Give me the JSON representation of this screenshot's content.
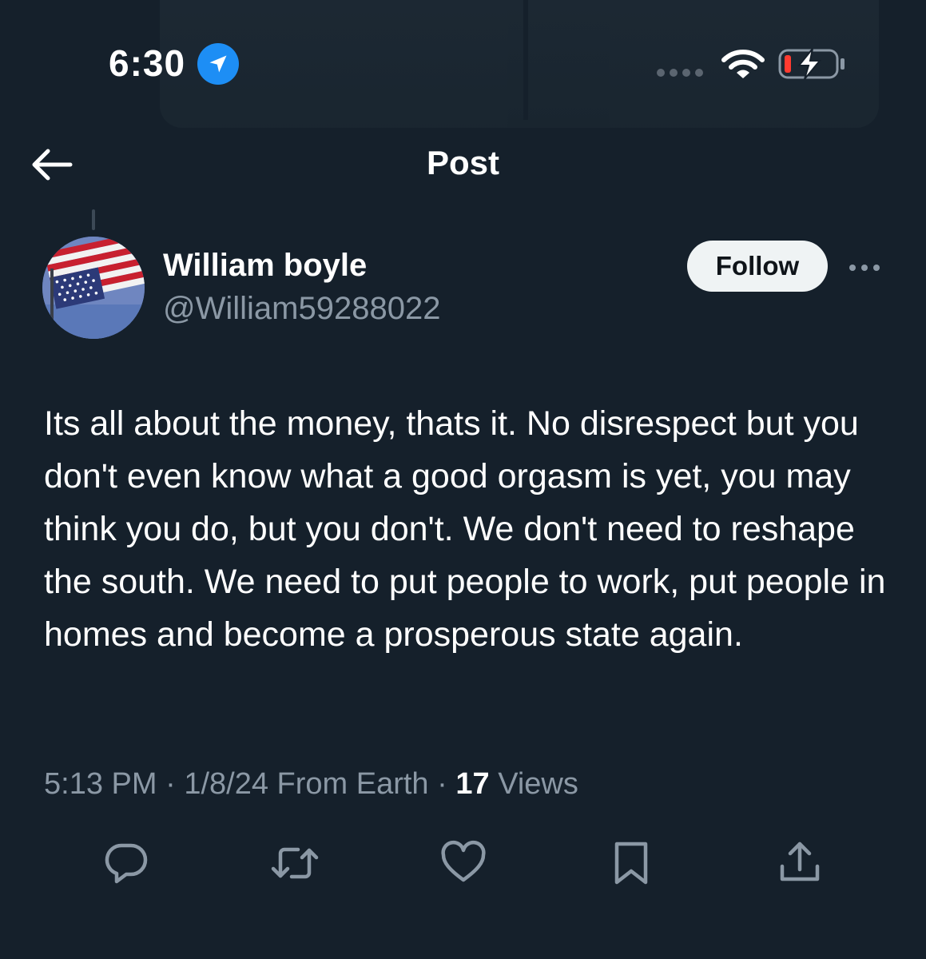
{
  "status_bar": {
    "time": "6:30",
    "location_icon": "location-arrow-icon",
    "signal_icon": "signal-dots-icon",
    "wifi_icon": "wifi-icon",
    "battery_icon": "battery-charging-low-icon"
  },
  "nav": {
    "title": "Post",
    "back_icon": "arrow-left-icon"
  },
  "post": {
    "author_name": "William boyle",
    "author_handle": "@William59288022",
    "follow_label": "Follow",
    "more_icon": "more-horizontal-icon",
    "text": "Its all about the money, thats it. No disrespect but you don't even know what a good orgasm is yet, you may think you do, but you don't. We don't need to reshape the south. We need to put people to work, put people in homes and become a prosperous state again.",
    "time": "5:13 PM",
    "separator": " · ",
    "date": "1/8/24",
    "source": " From Earth",
    "views_count": "17",
    "views_label": " Views"
  },
  "actions": [
    {
      "name": "reply",
      "icon": "reply-icon"
    },
    {
      "name": "repost",
      "icon": "repost-icon"
    },
    {
      "name": "like",
      "icon": "heart-icon"
    },
    {
      "name": "bookmark",
      "icon": "bookmark-icon"
    },
    {
      "name": "share",
      "icon": "share-icon"
    }
  ],
  "colors": {
    "background": "#15202b",
    "text_primary": "#ffffff",
    "text_secondary": "#8b98a5",
    "follow_button_bg": "#eff3f4",
    "follow_button_text": "#0f1419",
    "location_badge": "#1d8ef5",
    "battery_low": "#ff3b30"
  }
}
